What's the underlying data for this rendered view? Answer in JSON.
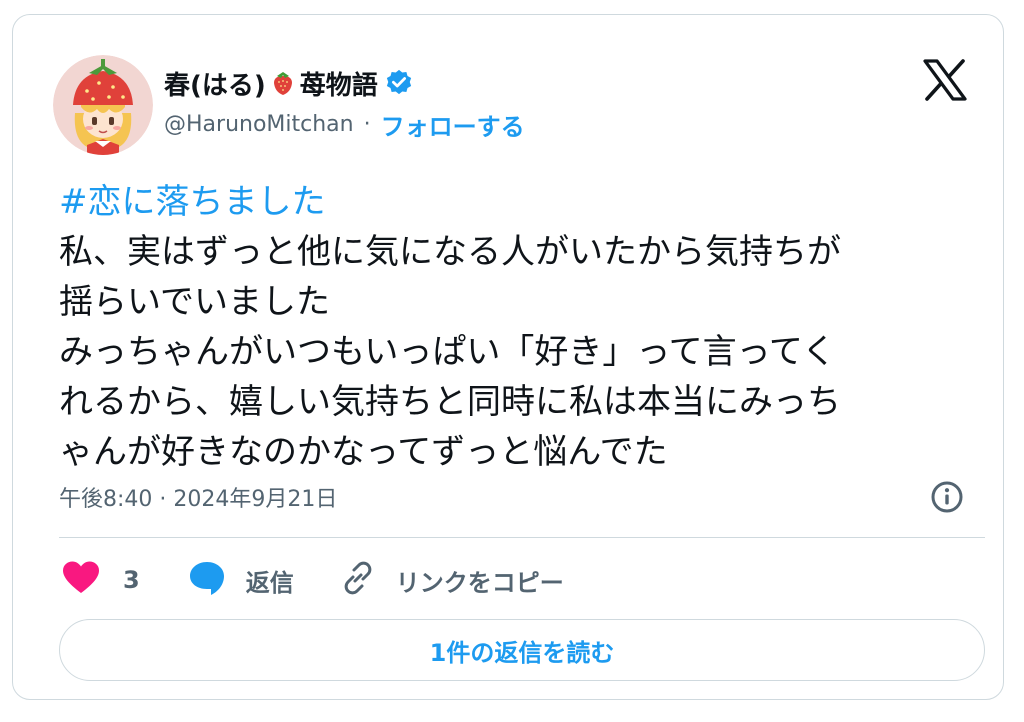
{
  "author": {
    "display_name": "春(はる)",
    "display_name_suffix": "苺物語",
    "handle": "@HarunoMitchan",
    "separator": "·",
    "follow_label": "フォローする",
    "verified": true,
    "avatar_icon": "strawberry-hat-girl-avatar"
  },
  "tweet": {
    "lines": [
      "#恋に落ちました",
      "私、実はずっと他に気になる人がいたから気持ちが",
      "揺らいでいました",
      "みっちゃんがいつもいっぱい「好き」って言ってく",
      "れるから、嬉しい気持ちと同時に私は本当にみっち",
      "ゃんが好きなのかなってずっと悩んでた"
    ],
    "timestamp": "午後8:40 · 2024年9月21日"
  },
  "actions": {
    "like_count": "3",
    "reply_label": "返信",
    "copy_link_label": "リンクをコピー"
  },
  "read_replies_label": "1件の返信を読む",
  "colors": {
    "accent": "#1d9bf0",
    "like": "#f91880",
    "text": "#0f1419",
    "muted": "#536471",
    "border": "#cfd9de"
  },
  "icons": [
    "strawberry-icon",
    "verified-badge-icon",
    "x-logo-icon",
    "info-icon",
    "heart-icon",
    "reply-bubble-icon",
    "link-icon"
  ]
}
